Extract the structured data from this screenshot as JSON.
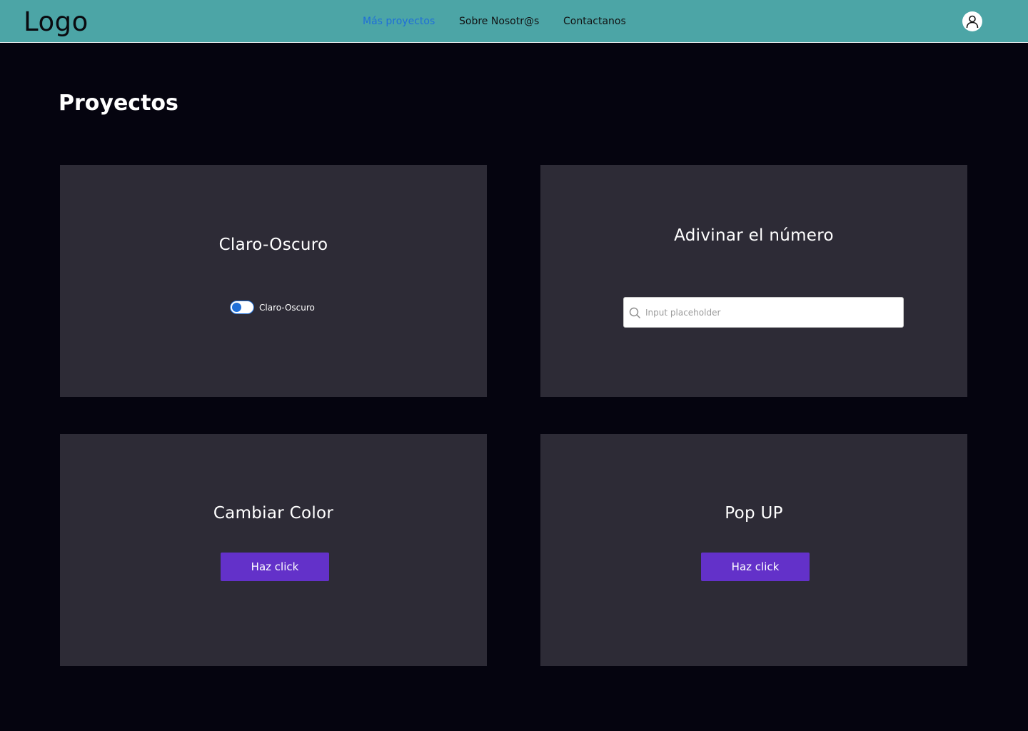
{
  "header": {
    "logo": "Logo",
    "nav": [
      {
        "label": "Más proyectos",
        "active": true
      },
      {
        "label": "Sobre Nosotr@s",
        "active": false
      },
      {
        "label": "Contactanos",
        "active": false
      }
    ],
    "avatar_icon": "user-icon",
    "background_color": "#4ca5a6",
    "active_nav_color": "#1f6fd8"
  },
  "page": {
    "title": "Proyectos",
    "background_color": "#05040f"
  },
  "cards": {
    "claro_oscuro": {
      "title": "Claro-Oscuro",
      "toggle_label": "Claro-Oscuro"
    },
    "adivinar": {
      "title": "Adivinar el número",
      "input_placeholder": "Input placeholder",
      "input_value": "",
      "input_icon": "search-icon"
    },
    "cambiar_color": {
      "title": "Cambiar Color",
      "button_label": "Haz click"
    },
    "popup": {
      "title": "Pop UP",
      "button_label": "Haz click"
    },
    "card_color": "#2d2b36",
    "button_color": "#6331c9"
  }
}
